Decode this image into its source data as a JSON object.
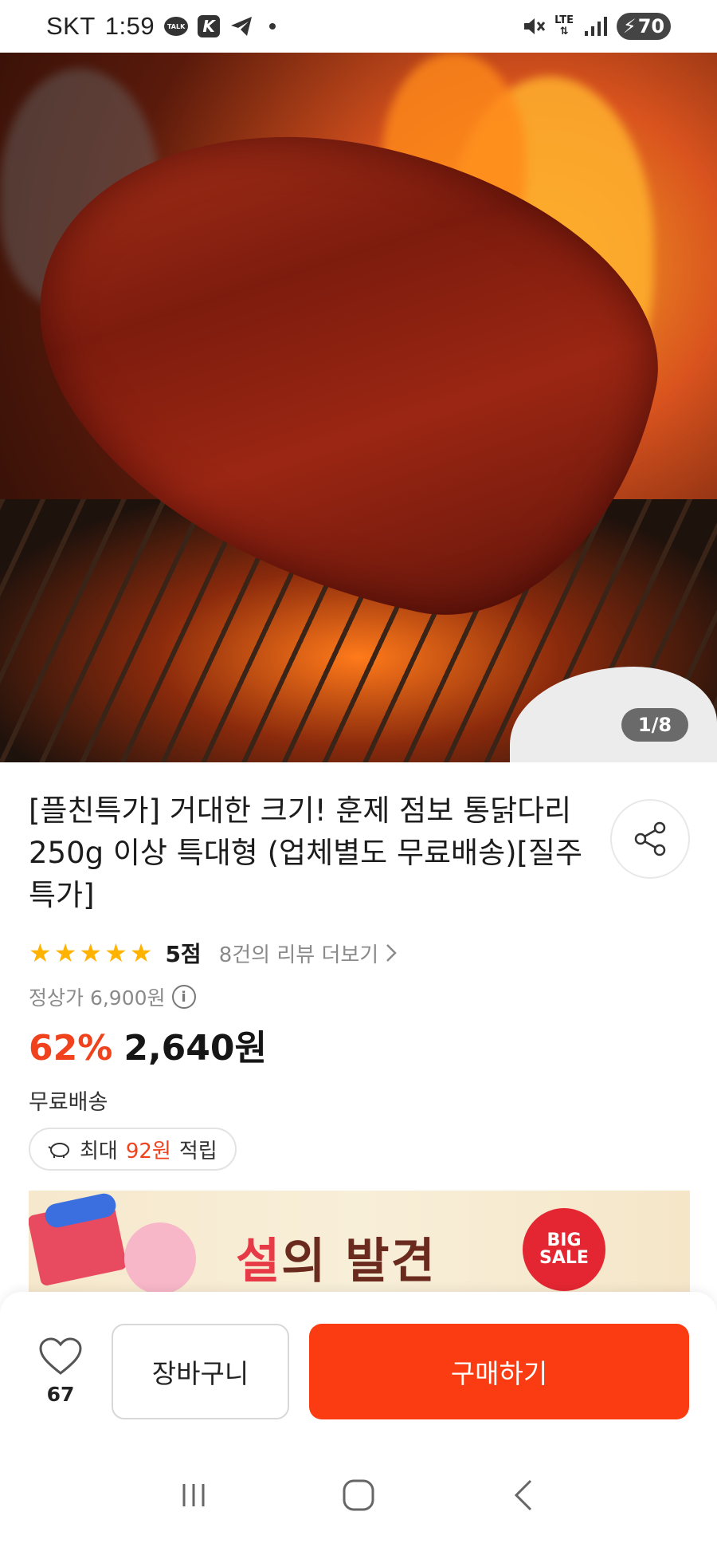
{
  "status_bar": {
    "carrier": "SKT",
    "time": "1:59",
    "network": "LTE",
    "battery": "70",
    "icons": [
      "talk-icon",
      "k-icon",
      "telegram-icon",
      "dot-icon",
      "mute-icon",
      "lte-icon",
      "signal-icon",
      "battery-icon"
    ]
  },
  "gallery": {
    "counter": "1/8",
    "current": 1,
    "total": 8
  },
  "product": {
    "title": "[플친특가] 거대한 크기! 훈제 점보 통닭다리 250g 이상 특대형 (업체별도 무료배송)[질주특가]",
    "rating_score": "5점",
    "rating_value": 5,
    "review_link": "8건의 리뷰 더보기",
    "regular_price": "정상가 6,900원",
    "discount": "62%",
    "price": "2,640원",
    "shipping": "무료배송",
    "points_prefix": "최대",
    "points_amount": "92원",
    "points_suffix": "적립"
  },
  "banner": {
    "text_highlight": "설",
    "text_rest": "의 발견",
    "badge_line1": "BIG",
    "badge_line2": "SALE"
  },
  "action_bar": {
    "like_count": "67",
    "cart_label": "장바구니",
    "buy_label": "구매하기"
  },
  "colors": {
    "accent": "#fb3c12",
    "discount": "#f0421d",
    "star": "#ffb300"
  }
}
